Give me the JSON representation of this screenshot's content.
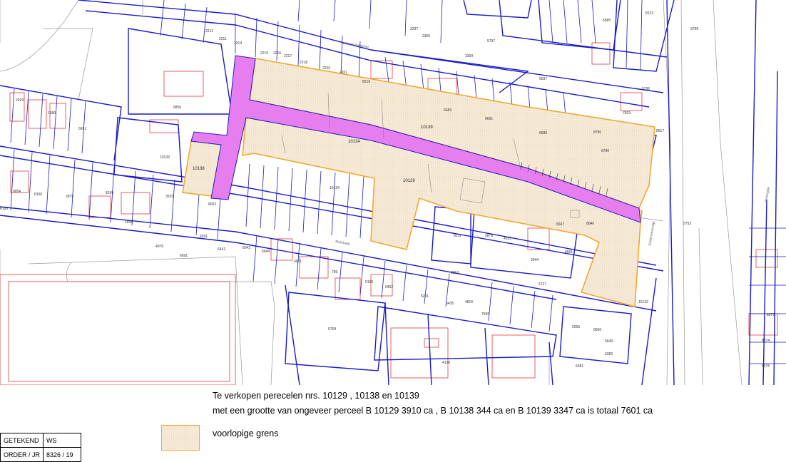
{
  "map": {
    "sale_parcel_labels": [
      "10139",
      "10138",
      "10129"
    ],
    "road_label": "10134",
    "street_names": [
      "Wilhelminastraat",
      "Molstraat",
      "Zuiderweverdijk",
      "Verlengde"
    ],
    "parcel_numbers": [
      "6856",
      "6691",
      "10133",
      "8100",
      "3975",
      "8199",
      "1898",
      "4076",
      "6691",
      "6441",
      "6043",
      "6644",
      "4061",
      "789",
      "5160",
      "6452",
      "5201",
      "6435",
      "4816",
      "7565",
      "5759",
      "4126",
      "6381",
      "6055",
      "6650",
      "6649",
      "6382",
      "8273",
      "8274",
      "8275",
      "8046",
      "6581",
      "5727",
      "2878",
      "4105",
      "6044",
      "5753",
      "10132",
      "8216",
      "6683",
      "6689",
      "6691",
      "5797",
      "6597",
      "6790",
      "8790",
      "7829",
      "5795",
      "8123",
      "9798",
      "8517",
      "6585",
      "8211",
      "2309",
      "2305",
      "2237",
      "2311",
      "2212",
      "2314",
      "2215",
      "2216",
      "2217",
      "2218",
      "2220",
      "2201",
      "6195",
      "3535",
      "8054",
      "8002",
      "8212",
      "6591",
      "2929",
      "1680",
      "6667",
      "10134"
    ],
    "colors": {
      "parcel_line": "#1a1ac8",
      "cadastral_line": "#e23a3a",
      "sale_fill": "#f6ead6",
      "sale_border": "#f0a830",
      "road_fill": "#e77ef0"
    }
  },
  "description": {
    "line1": "Te verkopen perecelen nrs. 10129 , 10138 en 10139",
    "line2": "met een grootte van ongeveer perceel B 10129  3910 ca ,  B 10138  344 ca en B 10139  3347 ca is totaal 7601 ca"
  },
  "legend": {
    "label": "voorlopige grens"
  },
  "stamp": {
    "row1_key": "GETEKEND",
    "row1_val": "WS",
    "row2_key": "ORDER / JR",
    "row2_val": "8326 / 19"
  }
}
